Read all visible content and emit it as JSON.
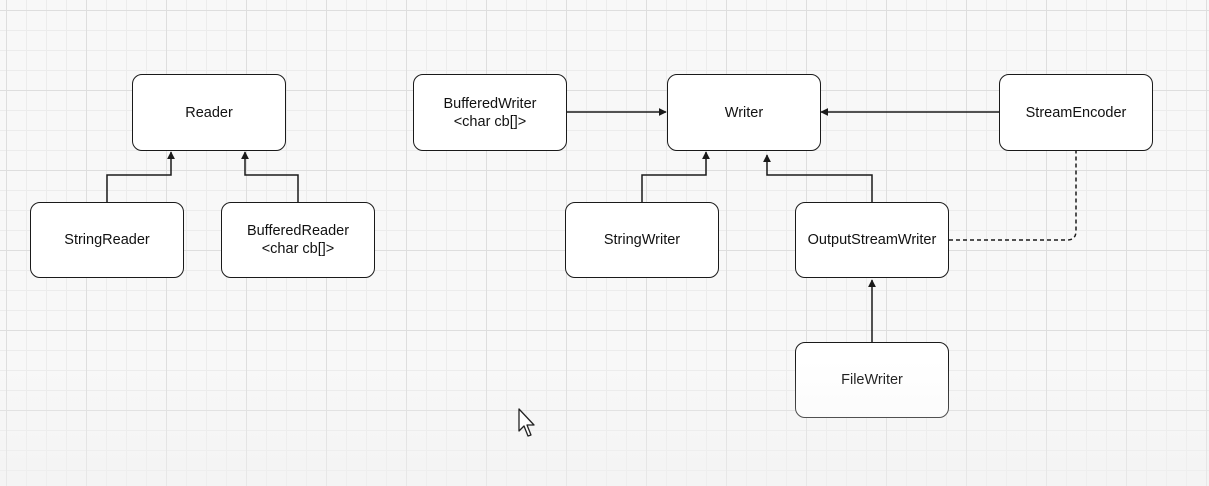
{
  "diagram": {
    "nodes": {
      "reader": {
        "label": "Reader"
      },
      "string_reader": {
        "label": "StringReader"
      },
      "buffered_reader": {
        "line1": "BufferedReader",
        "line2": "<char cb[]>"
      },
      "buffered_writer": {
        "line1": "BufferedWriter",
        "line2": "<char cb[]>"
      },
      "writer": {
        "label": "Writer"
      },
      "stream_encoder": {
        "label": "StreamEncoder"
      },
      "string_writer": {
        "label": "StringWriter"
      },
      "output_stream_writer": {
        "label": "OutputStreamWriter"
      },
      "file_writer": {
        "label": "FileWriter"
      }
    },
    "edges": [
      {
        "from": "StringReader",
        "to": "Reader",
        "style": "solid"
      },
      {
        "from": "BufferedReader",
        "to": "Reader",
        "style": "solid"
      },
      {
        "from": "BufferedWriter",
        "to": "Writer",
        "style": "solid"
      },
      {
        "from": "StreamEncoder",
        "to": "Writer",
        "style": "solid"
      },
      {
        "from": "StringWriter",
        "to": "Writer",
        "style": "solid"
      },
      {
        "from": "OutputStreamWriter",
        "to": "Writer",
        "style": "solid"
      },
      {
        "from": "FileWriter",
        "to": "OutputStreamWriter",
        "style": "solid"
      },
      {
        "from": "OutputStreamWriter",
        "to": "StreamEncoder",
        "style": "dashed"
      }
    ]
  },
  "colors": {
    "background": "#f8f8f8",
    "grid": "#dedede",
    "stroke": "#1a1a1a",
    "node_fill": "#ffffff"
  }
}
